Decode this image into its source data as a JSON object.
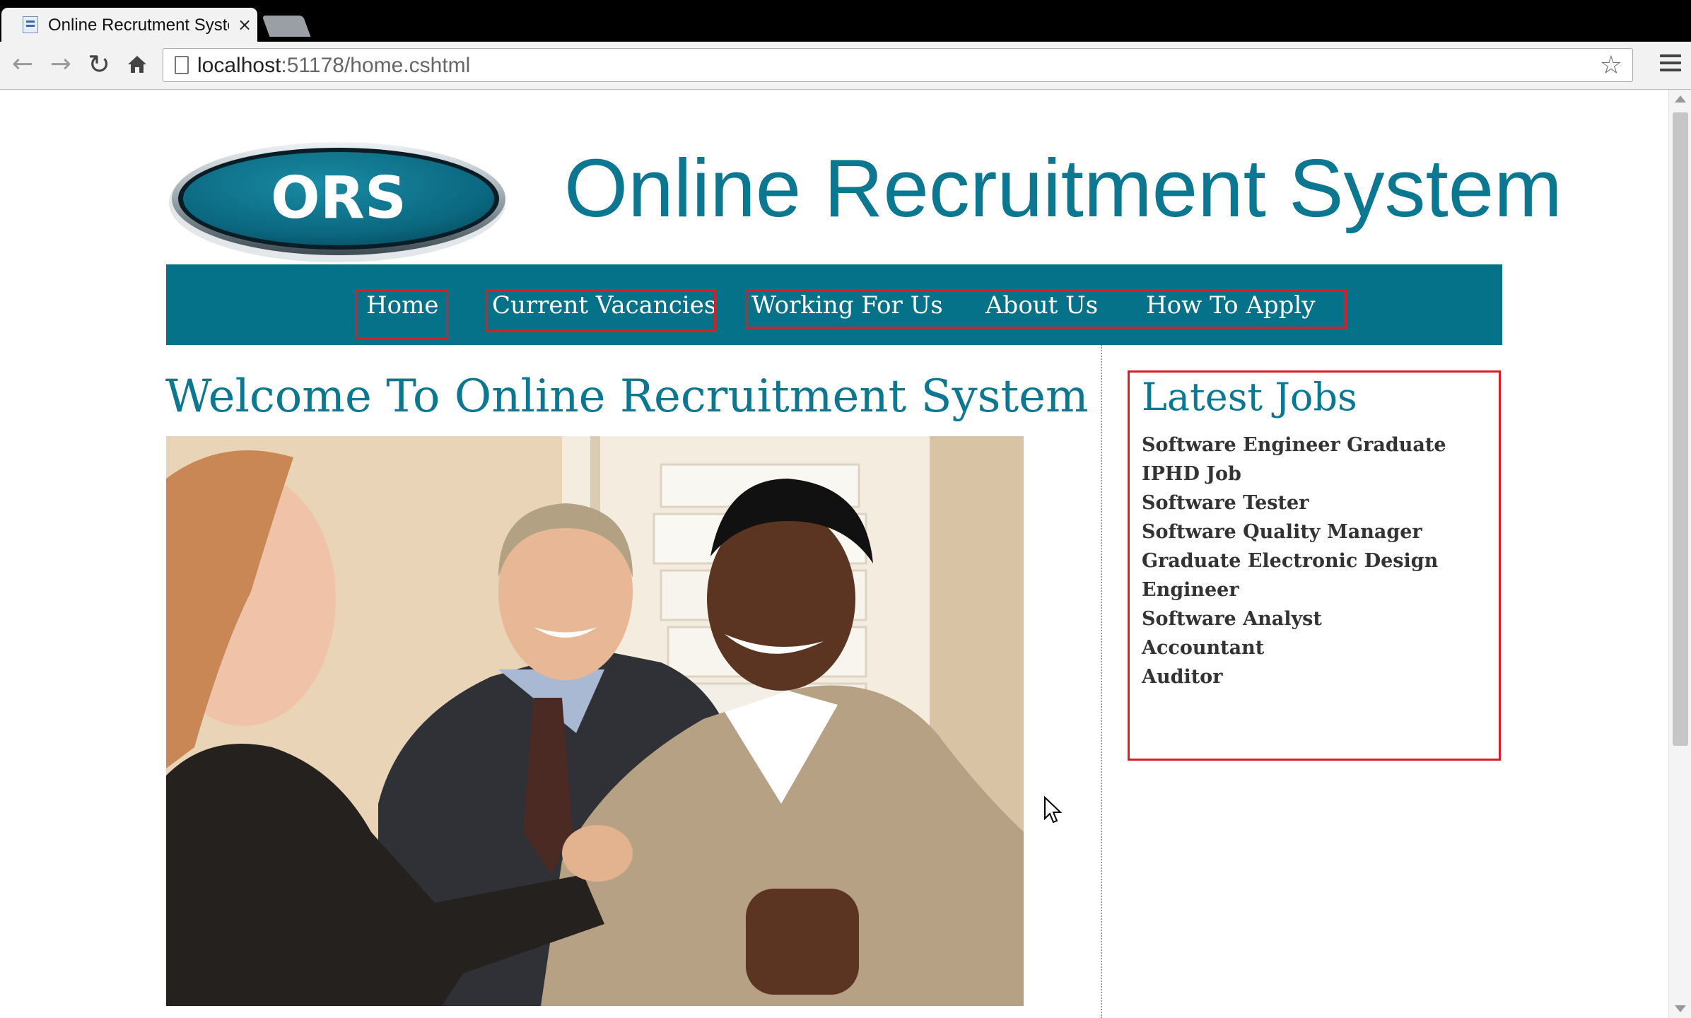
{
  "browser": {
    "tab_title": "Online Recrutment System",
    "tab_close": "×",
    "url_host": "localhost",
    "url_rest": ":51178/home.cshtml",
    "back_icon": "back-arrow-icon",
    "forward_icon": "forward-arrow-icon",
    "reload_icon": "reload-icon",
    "home_icon": "home-icon",
    "bookmark_icon": "star-icon",
    "menu_icon": "hamburger-menu-icon"
  },
  "header": {
    "logo_text": "ORS",
    "site_title": "Online Recruitment System"
  },
  "nav": {
    "items": [
      {
        "label": "Home"
      },
      {
        "label": "Current Vacancies"
      },
      {
        "label": "Working For Us"
      },
      {
        "label": "About Us"
      },
      {
        "label": "How To Apply"
      }
    ]
  },
  "main": {
    "welcome_heading": "Welcome To Online Recruitment System"
  },
  "sidebar": {
    "latest_jobs_title": "Latest Jobs",
    "jobs": [
      "Software Engineer Graduate IPHD Job",
      "Software Tester",
      "Software Quality Manager",
      "Graduate Electronic Design Engineer",
      "Software Analyst",
      "Accountant",
      "Auditor"
    ]
  },
  "colors": {
    "brand_teal": "#067289",
    "heading_teal": "#0b7790",
    "highlight_red": "#d81f26"
  }
}
